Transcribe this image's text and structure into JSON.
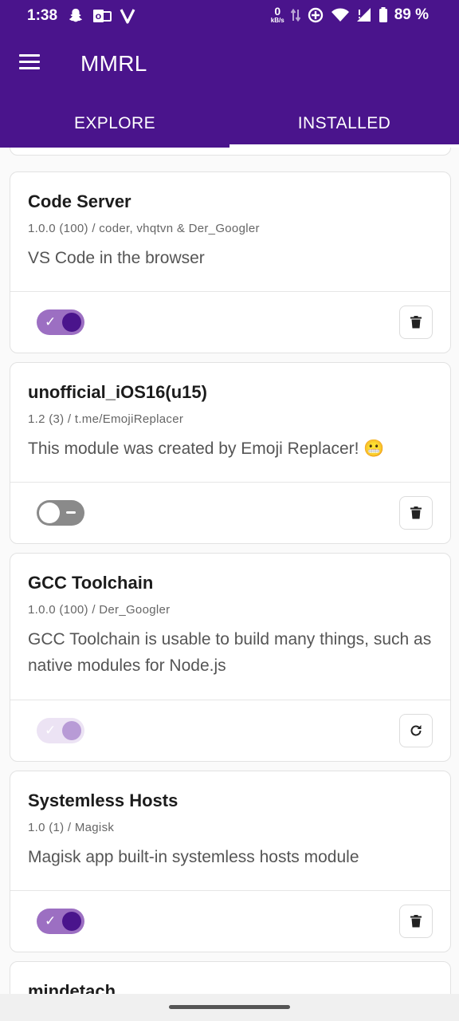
{
  "status_bar": {
    "time": "1:38",
    "net_speed_value": "0",
    "net_speed_unit": "kB/s",
    "battery_percent": "89 %",
    "icons": [
      "snapchat-icon",
      "outlook-icon",
      "v-app-icon",
      "data-arrows-icon",
      "sync-icon",
      "wifi-icon",
      "signal-icon",
      "battery-icon"
    ]
  },
  "app": {
    "title": "MMRL",
    "accent_color": "#4a148c"
  },
  "tabs": [
    {
      "label": "EXPLORE",
      "active": false
    },
    {
      "label": "INSTALLED",
      "active": true
    }
  ],
  "modules": [
    {
      "title": "Code Server",
      "meta": "1.0.0 (100) / coder, vhqtvn & Der_Googler",
      "description": "VS Code in the browser",
      "toggle_state": "on",
      "action": "delete-icon"
    },
    {
      "title": "unofficial_iOS16(u15)",
      "meta": "1.2 (3) / t.me/EmojiReplacer",
      "description": "This module was created by Emoji Replacer! 😬",
      "toggle_state": "off",
      "action": "delete-icon"
    },
    {
      "title": "GCC Toolchain",
      "meta": "1.0.0 (100) / Der_Googler",
      "description": "GCC Toolchain is usable to build many things, such as native modules for Node.js",
      "toggle_state": "disabled-on",
      "action": "restore-icon"
    },
    {
      "title": "Systemless Hosts",
      "meta": "1.0 (1) / Magisk",
      "description": "Magisk app built-in systemless hosts module",
      "toggle_state": "on",
      "action": "delete-icon"
    },
    {
      "title": "mindetach"
    }
  ]
}
